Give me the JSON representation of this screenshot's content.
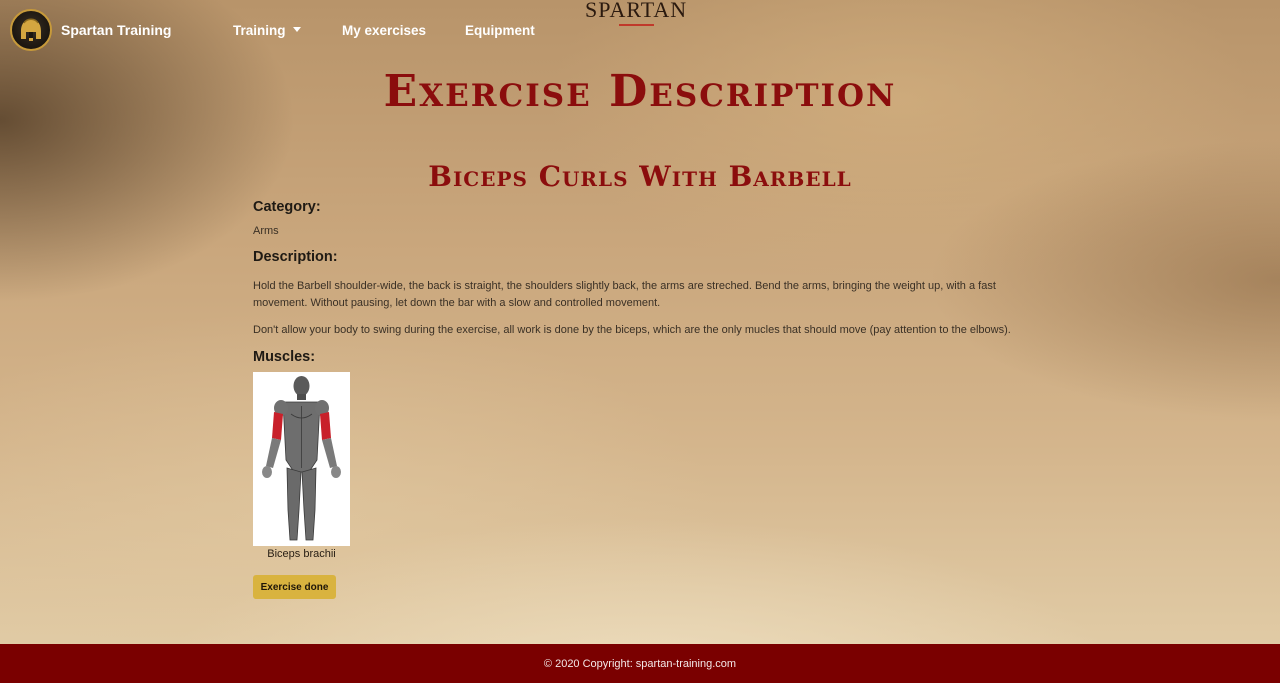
{
  "navbar": {
    "brand_name": "Spartan Training",
    "items": [
      {
        "label": "Training"
      },
      {
        "label": "My exercises"
      },
      {
        "label": "Equipment"
      }
    ],
    "site_logo": "SPARTAN"
  },
  "page": {
    "title": "Exercise Description"
  },
  "exercise": {
    "name": "Biceps Curls With Barbell",
    "category_label": "Category:",
    "category_value": "Arms",
    "description_label": "Description:",
    "description_paragraphs": [
      "Hold the Barbell shoulder-wide, the back is straight, the shoulders slightly back, the arms are streched. Bend the arms, bringing the weight up, with a fast movement. Without pausing, let down the bar with a slow and controlled movement.",
      "Don't allow your body to swing during the exercise, all work is done by the biceps, which are the only mucles that should move (pay attention to the elbows)."
    ],
    "muscles_label": "Muscles:",
    "muscles": [
      {
        "name": "Biceps brachii"
      }
    ],
    "done_button_label": "Exercise done"
  },
  "footer": {
    "copyright": "© 2020 Copyright: spartan-training.com"
  },
  "colors": {
    "title_red": "#8b0d0d",
    "footer_bg": "#7a0000",
    "button_gold": "#d9b33f",
    "highlight_muscle": "#c8202a"
  }
}
